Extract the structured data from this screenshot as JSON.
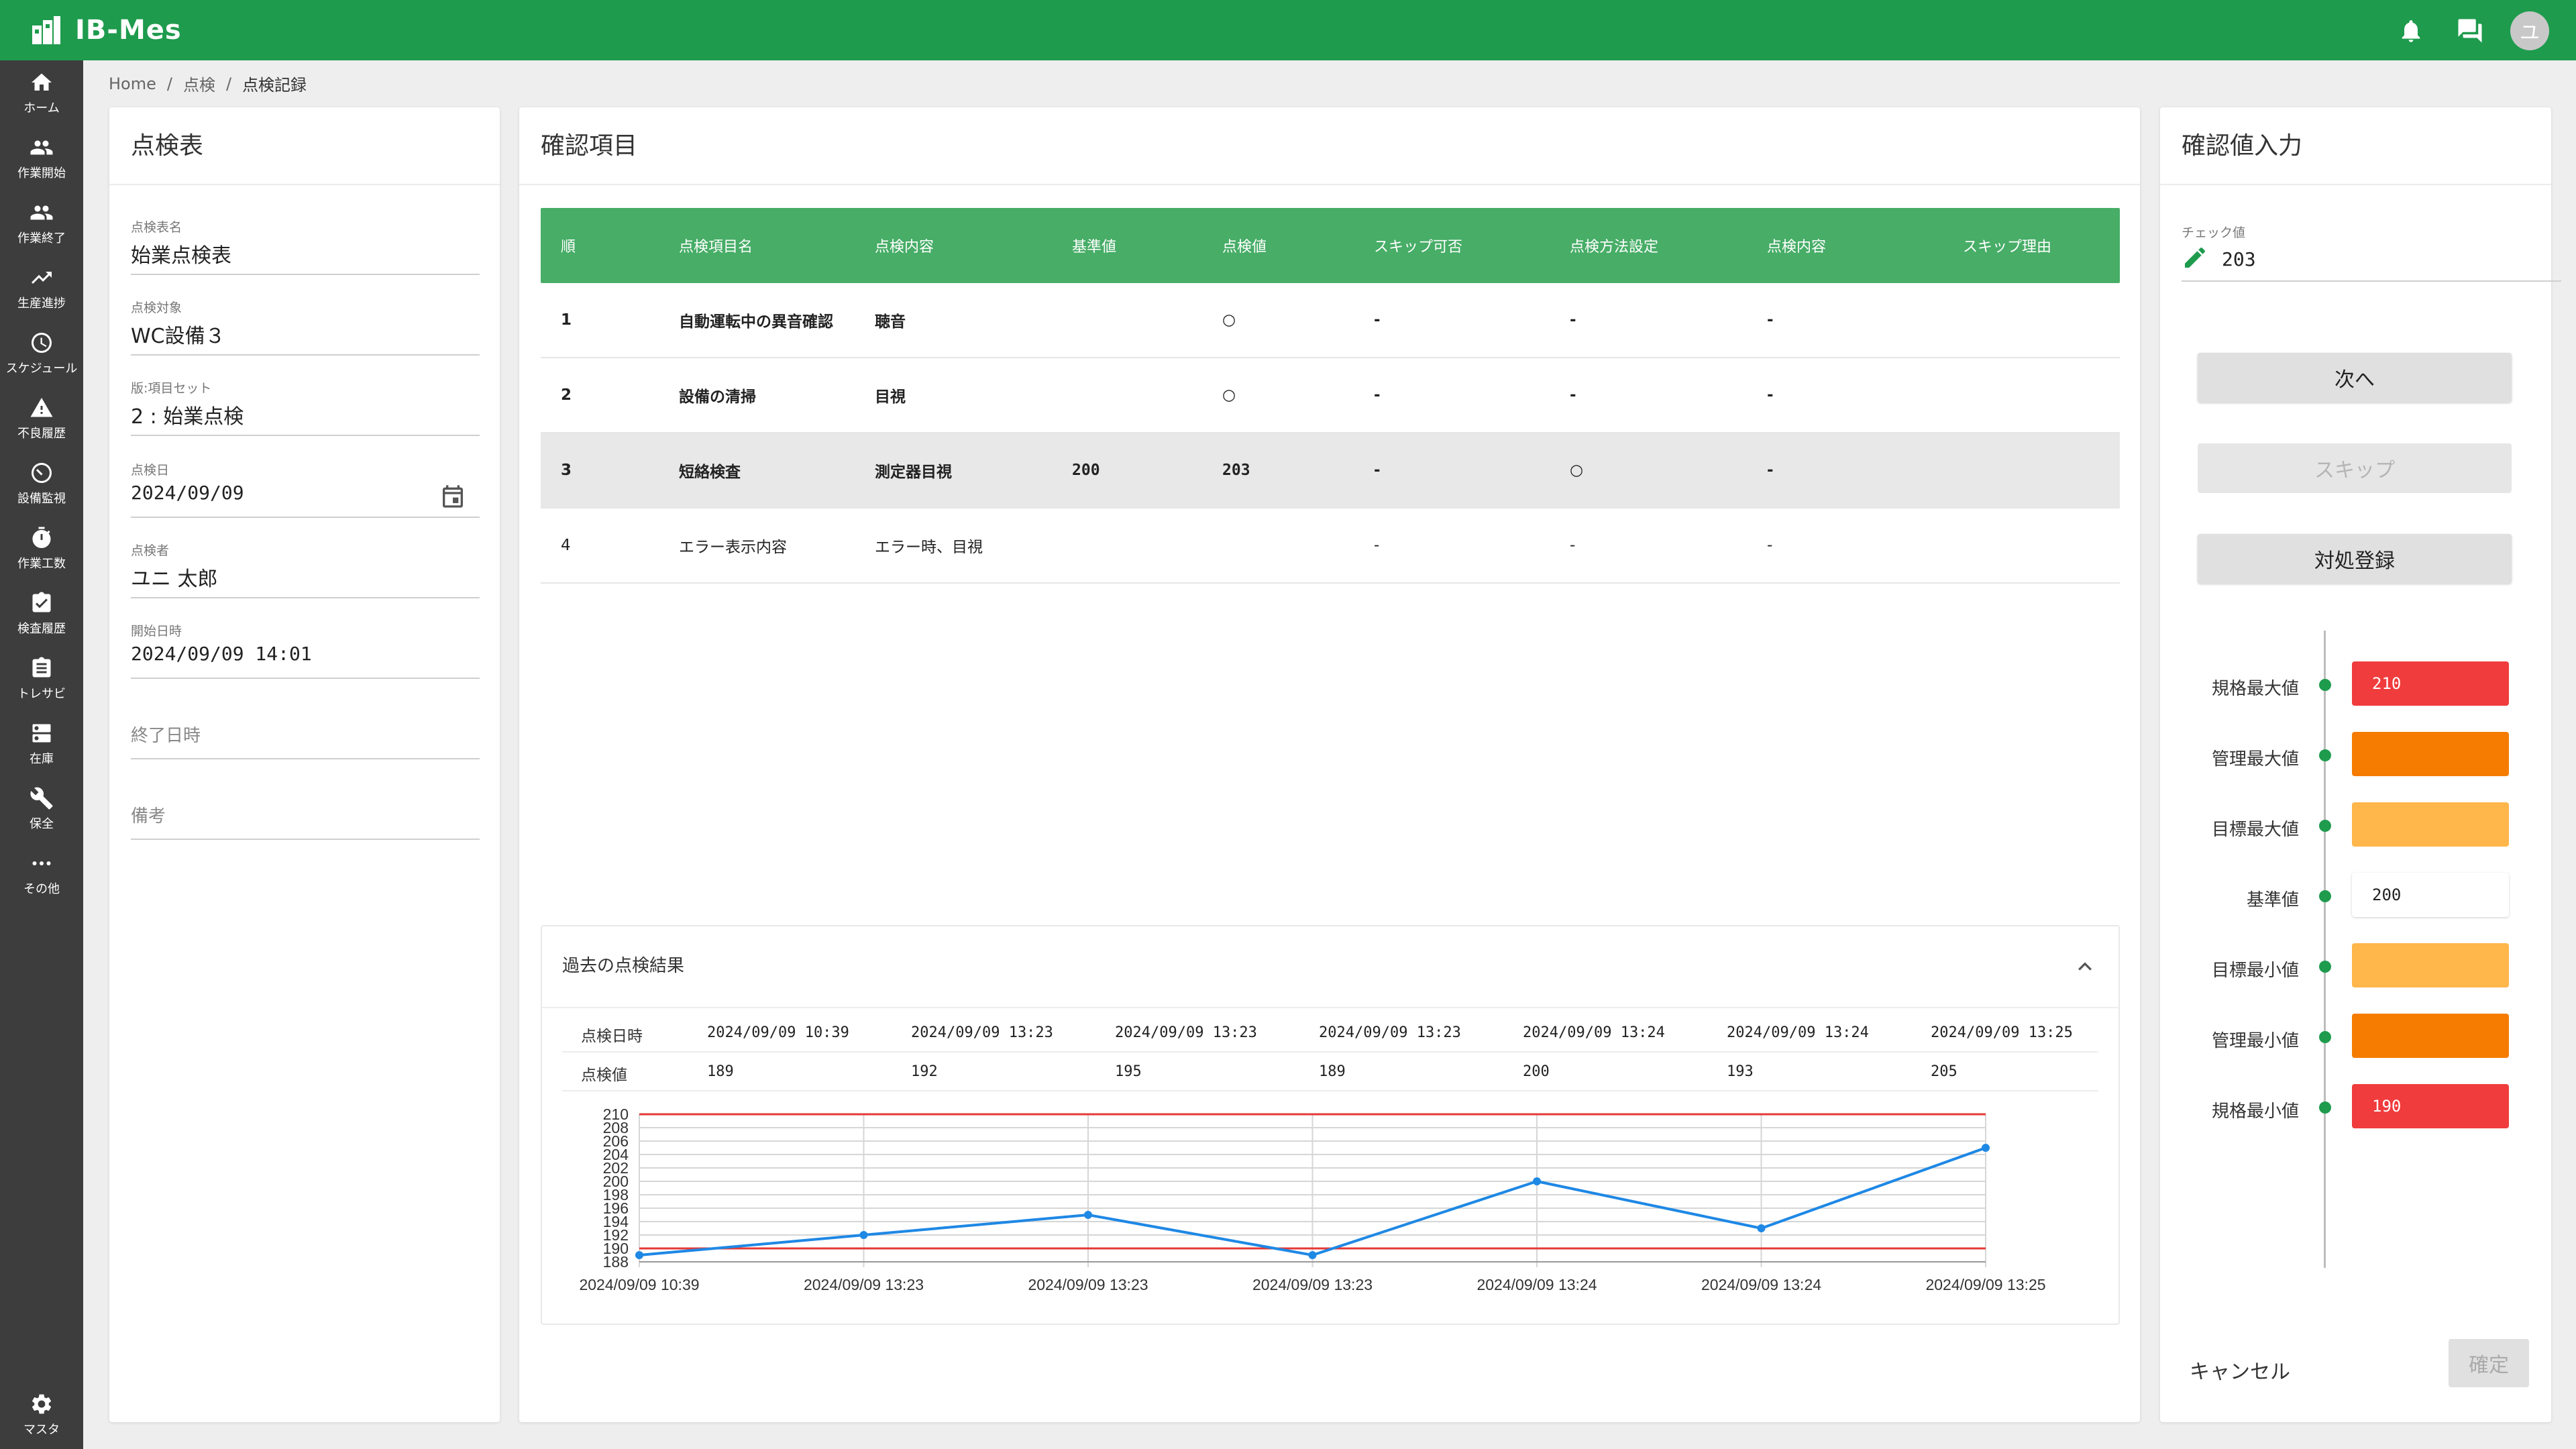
{
  "app": {
    "title": "IB-Mes",
    "avatar_initial": "ユ"
  },
  "topbar": {
    "icons": [
      "bell-icon",
      "chat-icon"
    ]
  },
  "sidebar": {
    "items": [
      {
        "label": "ホーム",
        "icon": "home-icon"
      },
      {
        "label": "作業開始",
        "icon": "people-icon"
      },
      {
        "label": "作業終了",
        "icon": "people-icon"
      },
      {
        "label": "生産進捗",
        "icon": "trend-icon"
      },
      {
        "label": "スケジュール",
        "icon": "clock-icon"
      },
      {
        "label": "不良履歴",
        "icon": "warning-icon"
      },
      {
        "label": "設備監視",
        "icon": "timer-icon"
      },
      {
        "label": "作業工数",
        "icon": "stopwatch-icon"
      },
      {
        "label": "検査履歴",
        "icon": "clipboard-check-icon"
      },
      {
        "label": "トレサビ",
        "icon": "clipboard-icon"
      },
      {
        "label": "在庫",
        "icon": "inbox-icon"
      },
      {
        "label": "保全",
        "icon": "wrench-icon"
      },
      {
        "label": "その他",
        "icon": "more-icon"
      }
    ],
    "bottom": {
      "label": "マスタ",
      "icon": "gear-icon"
    }
  },
  "breadcrumb": {
    "home": "Home",
    "level1": "点検",
    "current": "点検記録"
  },
  "inspection_sheet": {
    "title": "点検表",
    "fields": [
      {
        "label": "点検表名",
        "value": "始業点検表"
      },
      {
        "label": "点検対象",
        "value": "WC設備３"
      },
      {
        "label": "版:項目セット",
        "value": "2 : 始業点検"
      },
      {
        "label": "点検日",
        "value": "2024/09/09"
      },
      {
        "label": "点検者",
        "value": "ユニ 太郎"
      },
      {
        "label": "開始日時",
        "value": "2024/09/09 14:01"
      }
    ],
    "end_placeholder": "終了日時",
    "notes_placeholder": "備考"
  },
  "check_items": {
    "title": "確認項目",
    "headers": [
      "順",
      "点検項目名",
      "点検内容",
      "基準値",
      "点検値",
      "スキップ可否",
      "点検方法設定",
      "点検内容",
      "スキップ理由"
    ],
    "rows": [
      {
        "no": "1",
        "name": "自動運転中の異音確認",
        "content": "聴音",
        "standard": "",
        "value": "○",
        "skippable": "-",
        "method": "-",
        "detail": "-",
        "reason": ""
      },
      {
        "no": "2",
        "name": "設備の清掃",
        "content": "目視",
        "standard": "",
        "value": "○",
        "skippable": "-",
        "method": "-",
        "detail": "-",
        "reason": ""
      },
      {
        "no": "3",
        "name": "短絡検査",
        "content": "測定器目視",
        "standard": "200",
        "value": "203",
        "skippable": "-",
        "method": "○",
        "detail": "-",
        "reason": ""
      },
      {
        "no": "4",
        "name": "エラー表示内容",
        "content": "エラー時、目視",
        "standard": "",
        "value": "",
        "skippable": "-",
        "method": "-",
        "detail": "-",
        "reason": ""
      }
    ]
  },
  "history": {
    "title": "過去の点検結果",
    "date_label": "点検日時",
    "value_label": "点検値",
    "dates": [
      "2024/09/09 10:39",
      "2024/09/09 13:23",
      "2024/09/09 13:23",
      "2024/09/09 13:23",
      "2024/09/09 13:24",
      "2024/09/09 13:24",
      "2024/09/09 13:25"
    ],
    "values": [
      "189",
      "192",
      "195",
      "189",
      "200",
      "193",
      "205"
    ]
  },
  "chart_data": {
    "type": "line",
    "x": [
      "2024/09/09 10:39",
      "2024/09/09 13:23",
      "2024/09/09 13:23",
      "2024/09/09 13:23",
      "2024/09/09 13:24",
      "2024/09/09 13:24",
      "2024/09/09 13:25"
    ],
    "series": [
      {
        "values": [
          189,
          192,
          195,
          189,
          200,
          193,
          205
        ],
        "color": "#1e88e5"
      }
    ],
    "limit_lines": [
      {
        "value": 210,
        "color": "#e53935"
      },
      {
        "value": 190,
        "color": "#e53935"
      }
    ],
    "ylim": [
      188,
      210
    ],
    "yticks": [
      188,
      190,
      192,
      194,
      196,
      198,
      200,
      202,
      204,
      206,
      208,
      210
    ],
    "grid": true
  },
  "input_panel": {
    "title": "確認値入力",
    "check_label": "チェック値",
    "check_value": "203",
    "buttons": {
      "next": "次へ",
      "skip": "スキップ",
      "action": "対処登録"
    },
    "spec": [
      {
        "label": "規格最大値",
        "value": "210",
        "style": "red"
      },
      {
        "label": "管理最大値",
        "value": "",
        "style": "orange"
      },
      {
        "label": "目標最大値",
        "value": "",
        "style": "lightorange"
      },
      {
        "label": "基準値",
        "value": "200",
        "style": "plain"
      },
      {
        "label": "目標最小値",
        "value": "",
        "style": "lightorange"
      },
      {
        "label": "管理最小値",
        "value": "",
        "style": "orange"
      },
      {
        "label": "規格最小値",
        "value": "190",
        "style": "red"
      }
    ],
    "cancel": "キャンセル",
    "confirm": "確定"
  },
  "colors": {
    "brand": "#1e9b4d",
    "table_header": "#47ad67",
    "sidebar": "#3d3d3d"
  }
}
